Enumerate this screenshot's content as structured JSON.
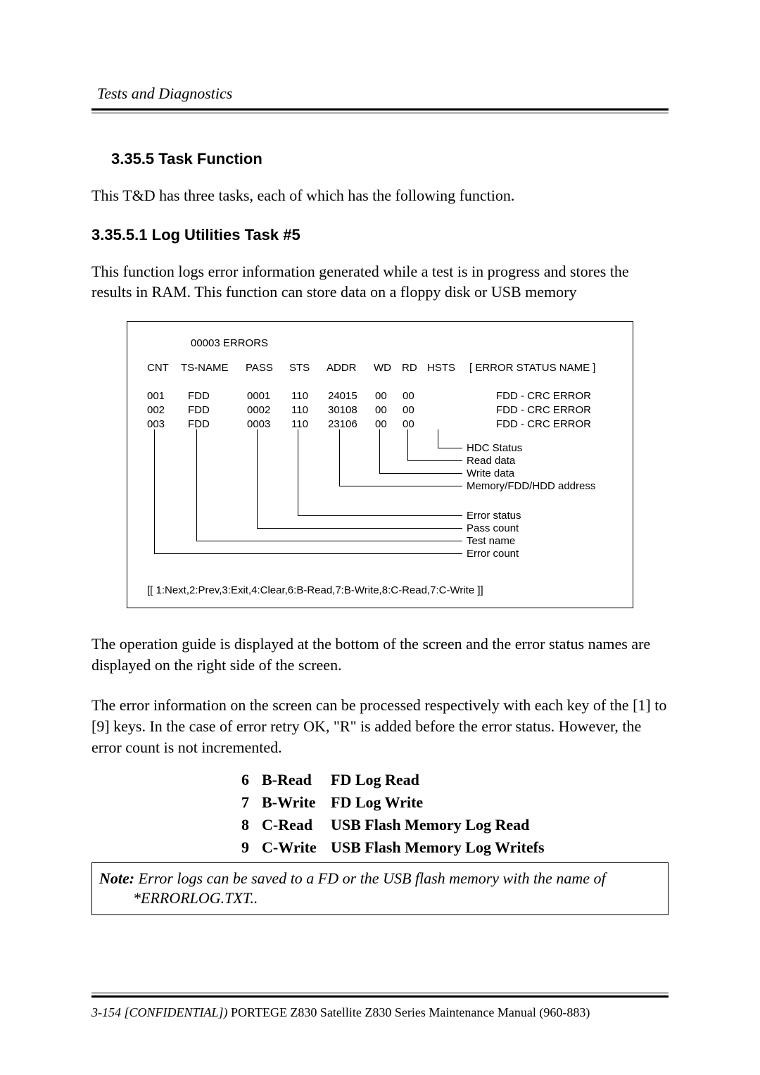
{
  "header": {
    "running": "Tests and Diagnostics"
  },
  "sec": {
    "h1": "3.35.5 Task Function",
    "p1": "This T&D has three tasks, each of which has the following function.",
    "h2": "3.35.5.1   Log Utilities    Task #5",
    "p2": "This function logs error information generated while a test is in progress and stores the results in RAM. This function can store data on a floppy disk or USB memory",
    "p3": "The operation guide is displayed at the bottom of the screen and the error status names are displayed on the right side of the screen.",
    "p4": "The error information on the screen can be processed respectively with each key of the [1] to [9] keys. In the case of error retry OK, \"R\" is added before the error status. However, the error count is not incremented."
  },
  "diagram": {
    "title": "00003 ERRORS",
    "cols": {
      "cnt": "CNT",
      "tsname": "TS-NAME",
      "pass": "PASS",
      "sts": "STS",
      "addr": "ADDR",
      "wd": "WD",
      "rd": "RD",
      "hsts": "HSTS",
      "esn": "[ ERROR STATUS NAME ]"
    },
    "rows": [
      {
        "cnt": "001",
        "tsname": "FDD",
        "pass": "0001",
        "sts": "110",
        "addr": "24015",
        "wd": "00",
        "rd": "00",
        "hsts": "",
        "esn": "FDD - CRC ERROR"
      },
      {
        "cnt": "002",
        "tsname": "FDD",
        "pass": "0002",
        "sts": "110",
        "addr": "30108",
        "wd": "00",
        "rd": "00",
        "hsts": "",
        "esn": "FDD - CRC ERROR"
      },
      {
        "cnt": "003",
        "tsname": "FDD",
        "pass": "0003",
        "sts": "110",
        "addr": "23106",
        "wd": "00",
        "rd": "00",
        "hsts": "",
        "esn": "FDD - CRC ERROR"
      }
    ],
    "legend1": [
      "HDC Status",
      "Read data",
      "Write data",
      "Memory/FDD/HDD address"
    ],
    "legend2": [
      "Error status",
      "Pass count",
      "Test name",
      "Error count"
    ],
    "footer": "[[ 1:Next,2:Prev,3:Exit,4:Clear,6:B-Read,7:B-Write,8:C-Read,7:C-Write ]]"
  },
  "keytable": [
    {
      "n": "6",
      "cmd": "B-Read",
      "desc": "FD Log Read"
    },
    {
      "n": "7",
      "cmd": "B-Write",
      "desc": "FD Log Write"
    },
    {
      "n": "8",
      "cmd": "C-Read",
      "desc": "USB Flash Memory Log Read"
    },
    {
      "n": "9",
      "cmd": "C-Write",
      "desc": "USB Flash Memory Log Writefs"
    }
  ],
  "note": {
    "label": "Note:",
    "text": " Error logs can be saved to a FD or the USB flash memory with the name of",
    "text2": "*ERRORLOG.TXT.."
  },
  "footer": {
    "left_italic": "3-154 [CONFIDENTIAL])",
    "left_rest": " PORTEGE Z830 Satellite Z830 Series Maintenance Manual (960-883)"
  }
}
